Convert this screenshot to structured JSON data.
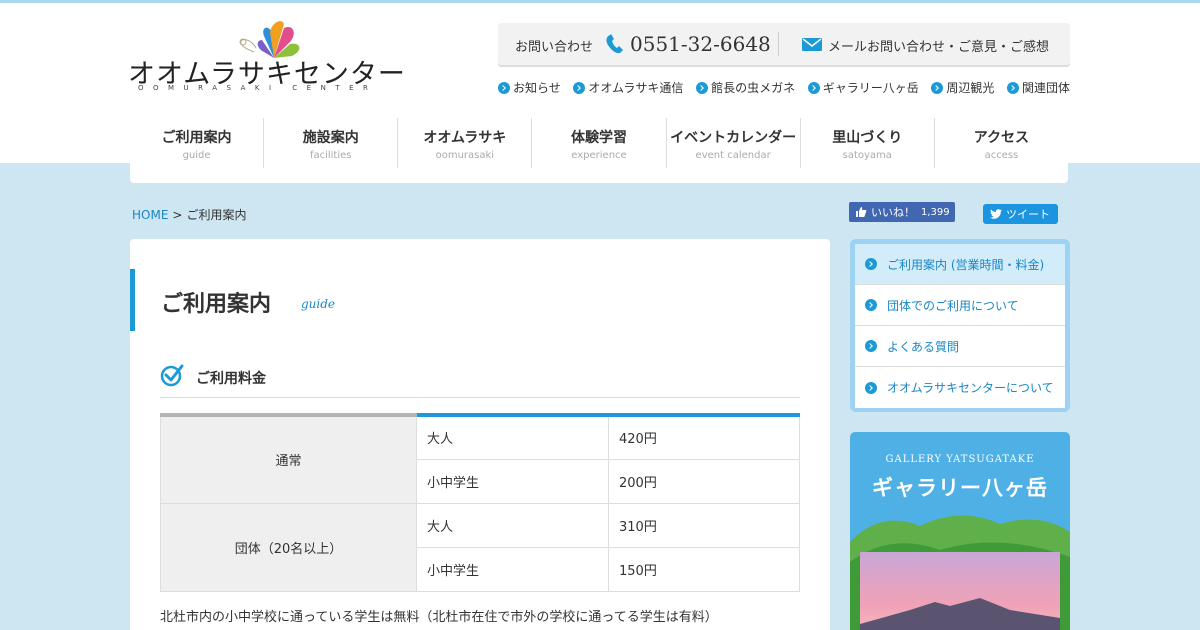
{
  "logo": {
    "text": "オオムラサキセンター",
    "sub": "OOMURASAKI CENTER"
  },
  "contact": {
    "label": "お問い合わせ",
    "phone": "0551-32-6648",
    "mail_label": "メールお問い合わせ・ご意見・ご感想"
  },
  "sub_links": [
    "お知らせ",
    "オオムラサキ通信",
    "館長の虫メガネ",
    "ギャラリー八ヶ岳",
    "周辺観光",
    "関連団体"
  ],
  "gnav": [
    {
      "jp": "ご利用案内",
      "en": "guide"
    },
    {
      "jp": "施設案内",
      "en": "facilities"
    },
    {
      "jp": "オオムラサキ",
      "en": "oomurasaki"
    },
    {
      "jp": "体験学習",
      "en": "experience"
    },
    {
      "jp": "イベントカレンダー",
      "en": "event calendar"
    },
    {
      "jp": "里山づくり",
      "en": "satoyama"
    },
    {
      "jp": "アクセス",
      "en": "access"
    }
  ],
  "breadcrumb": {
    "home": "HOME",
    "sep": ">",
    "current": "ご利用案内"
  },
  "social": {
    "fb_label": "いいね！",
    "fb_count": "1,399",
    "tw_label": "ツイート"
  },
  "page": {
    "title": "ご利用案内",
    "title_en": "guide",
    "section_title": "ご利用料金",
    "pricing": [
      {
        "category": "通常",
        "rows": [
          {
            "who": "大人",
            "price": "420円"
          },
          {
            "who": "小中学生",
            "price": "200円"
          }
        ]
      },
      {
        "category": "団体（20名以上）",
        "rows": [
          {
            "who": "大人",
            "price": "310円"
          },
          {
            "who": "小中学生",
            "price": "150円"
          }
        ]
      }
    ],
    "note": "北杜市内の小中学校に通っている学生は無料（北杜市在住で市外の学校に通ってる学生は有料）"
  },
  "side_menu": [
    "ご利用案内 (営業時間・料金)",
    "団体でのご利用について",
    "よくある質問",
    "オオムラサキセンターについて"
  ],
  "gallery": {
    "en": "GALLERY YATSUGATAKE",
    "jp": "ギャラリー八ヶ岳"
  },
  "colors": {
    "accent": "#1b9ad6",
    "link": "#1b86c4",
    "background": "#cde6f2",
    "facebook": "#4267b2",
    "twitter": "#1b95e0"
  }
}
